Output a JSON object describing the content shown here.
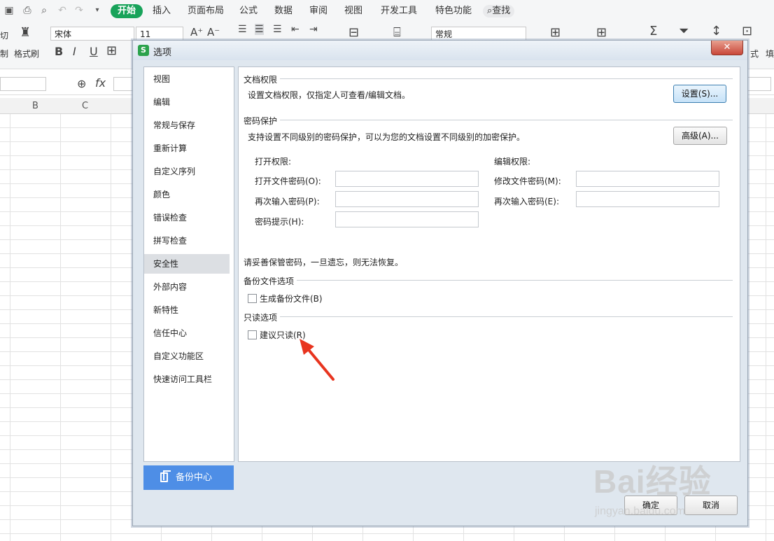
{
  "app": {
    "menu_tabs": [
      "开始",
      "插入",
      "页面布局",
      "公式",
      "数据",
      "审阅",
      "视图",
      "开发工具",
      "特色功能"
    ],
    "search_label": "查找",
    "toolbar": {
      "cut_partial": "切",
      "copy_partial": "制",
      "format_painter": "格式刷",
      "font_name": "宋体",
      "font_size": "11",
      "number_format": "常规",
      "bold": "B",
      "italic": "I",
      "underline": "U",
      "right_partial_1": "式",
      "right_partial_2": "填"
    },
    "formula_bar": {
      "fx": "fx"
    },
    "columns": [
      "B",
      "C"
    ]
  },
  "dialog": {
    "title": "选项",
    "close_label": "✕",
    "nav_items": [
      "视图",
      "编辑",
      "常规与保存",
      "重新计算",
      "自定义序列",
      "颜色",
      "错误检查",
      "拼写检查",
      "安全性",
      "外部内容",
      "新特性",
      "信任中心",
      "自定义功能区",
      "快速访问工具栏"
    ],
    "selected_nav": "安全性",
    "backup_center": "备份中心",
    "doc_permission": {
      "title": "文档权限",
      "desc": "设置文档权限，仅指定人可查看/编辑文档。",
      "button": "设置(S)..."
    },
    "password_protection": {
      "title": "密码保护",
      "desc": "支持设置不同级别的密码保护，可以为您的文档设置不同级别的加密保护。",
      "button": "高级(A)...",
      "open_title": "打开权限:",
      "open_password_label": "打开文件密码(O):",
      "open_password_value": "",
      "open_reenter_label": "再次输入密码(P):",
      "open_reenter_value": "",
      "hint_label": "密码提示(H):",
      "hint_value": "",
      "edit_title": "编辑权限:",
      "edit_password_label": "修改文件密码(M):",
      "edit_password_value": "",
      "edit_reenter_label": "再次输入密码(E):",
      "edit_reenter_value": "",
      "note": "请妥善保管密码，一旦遗忘，则无法恢复。"
    },
    "backup": {
      "title": "备份文件选项",
      "checkbox_label": "生成备份文件(B)",
      "checked": false
    },
    "readonly": {
      "title": "只读选项",
      "checkbox_label": "建议只读(R)",
      "checked": false
    },
    "ok_label": "确定",
    "cancel_label": "取消"
  },
  "watermark": {
    "text": "Bai经验",
    "url": "jingyan.baidu.com"
  },
  "colors": {
    "accent_green": "#18a35a",
    "nav_selected": "#dcdfe3",
    "backup_blue": "#4e8ee6",
    "arrow_red": "#e8341f"
  }
}
